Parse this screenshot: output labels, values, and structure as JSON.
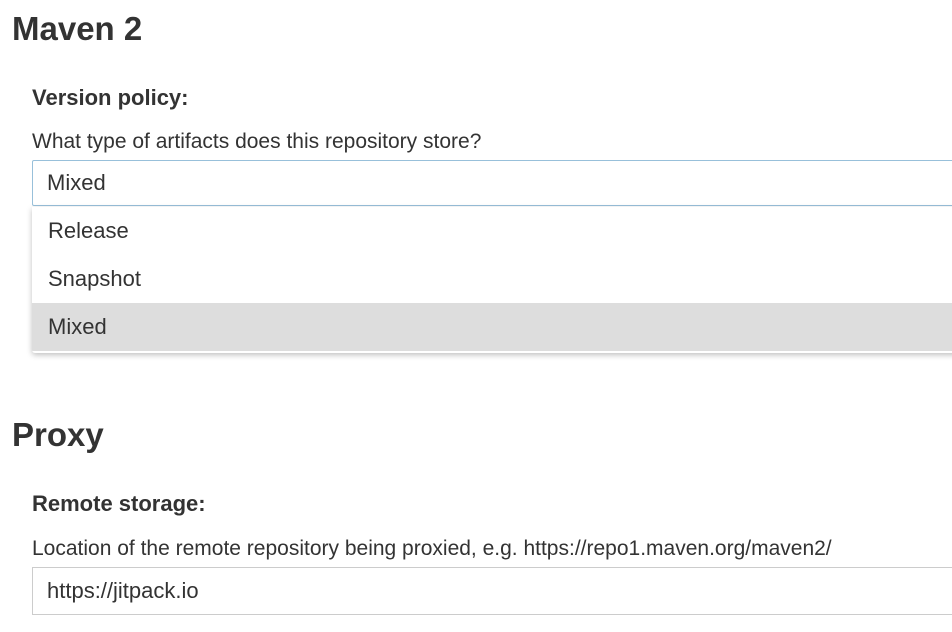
{
  "maven_section": {
    "title": "Maven 2",
    "version_policy": {
      "label": "Version policy:",
      "help": "What type of artifacts does this repository store?",
      "selected_value": "Mixed",
      "options": [
        "Release",
        "Snapshot",
        "Mixed"
      ],
      "highlighted_option": "Mixed"
    }
  },
  "proxy_section": {
    "title": "Proxy",
    "remote_storage": {
      "label": "Remote storage:",
      "help": "Location of the remote repository being proxied, e.g. https://repo1.maven.org/maven2/",
      "value": "https://jitpack.io"
    }
  },
  "colors": {
    "select_border": "#98c0da",
    "highlight_bg": "#dddddd",
    "text": "#333333"
  }
}
